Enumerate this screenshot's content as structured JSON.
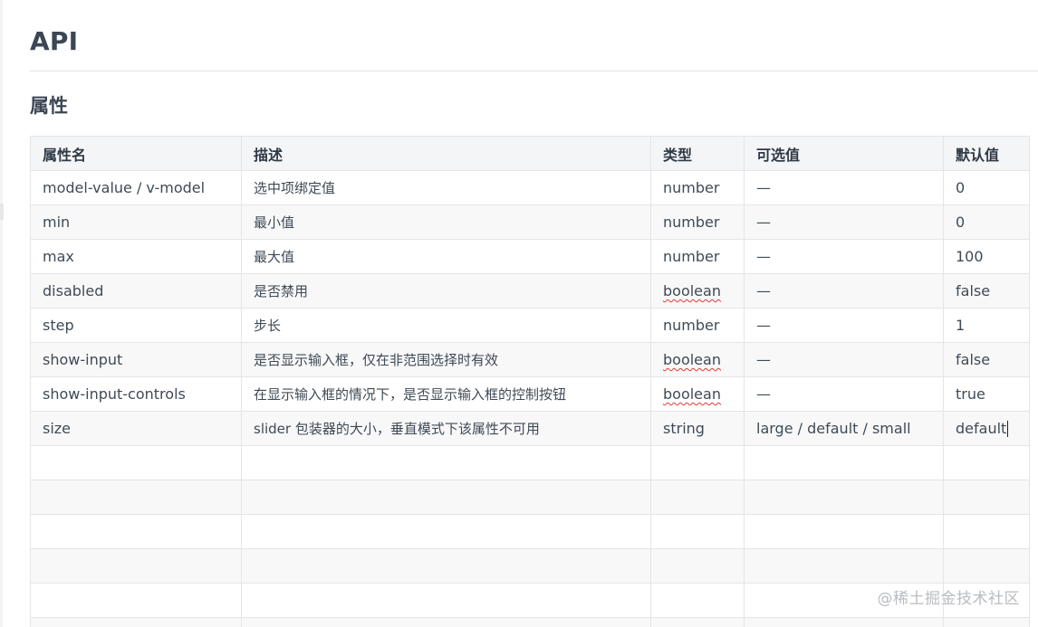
{
  "page": {
    "title": "API",
    "section_title": "属性"
  },
  "table": {
    "headers": [
      "属性名",
      "描述",
      "类型",
      "可选值",
      "默认值"
    ],
    "rows": [
      {
        "name": "model-value / v-model",
        "desc": "选中项绑定值",
        "type": "number",
        "options": "—",
        "default": "0"
      },
      {
        "name": "min",
        "desc": "最小值",
        "type": "number",
        "options": "—",
        "default": "0"
      },
      {
        "name": "max",
        "desc": "最大值",
        "type": "number",
        "options": "—",
        "default": "100"
      },
      {
        "name": "disabled",
        "desc": "是否禁用",
        "type": "boolean",
        "options": "—",
        "default": "false"
      },
      {
        "name": "step",
        "desc": "步长",
        "type": "number",
        "options": "—",
        "default": "1"
      },
      {
        "name": "show-input",
        "desc": "是否显示输入框，仅在非范围选择时有效",
        "type": "boolean",
        "options": "—",
        "default": "false"
      },
      {
        "name": "show-input-controls",
        "desc": "在显示输入框的情况下，是否显示输入框的控制按钮",
        "type": "boolean",
        "options": "—",
        "default": "true"
      },
      {
        "name": "size",
        "desc": "slider 包装器的大小，垂直模式下该属性不可用",
        "type": "string",
        "options": "large / default / small",
        "default": "default"
      }
    ]
  },
  "watermark": "@稀土掘金技术社区"
}
